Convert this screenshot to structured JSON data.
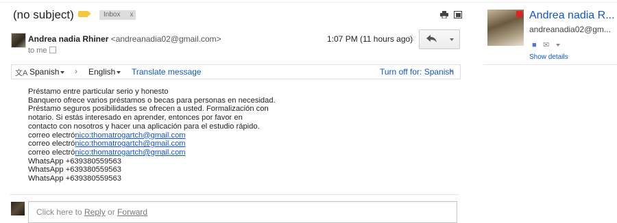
{
  "subject": "(no subject)",
  "label_color": "#f2c83e",
  "inbox_chip": {
    "label": "Inbox",
    "close": "x"
  },
  "sender": {
    "name": "Andrea nadia Rhiner",
    "email": "<andreanadia02@gmail.com>",
    "to": "to me",
    "time": "1:07 PM (11 hours ago)"
  },
  "translate": {
    "from": "Spanish",
    "arrow": "›",
    "to": "English",
    "action": "Translate message",
    "turn_off": "Turn off for: Spanish",
    "close": "×"
  },
  "body_lines": [
    "Préstamo entre particular serio y honesto",
    "Banquero ofrece varios préstamos o becas para personas en necesidad.",
    "Préstamo seguros posibilidades se ofrecen a usted. Formalización con",
    "notario. Si estás interesado en aprender, entonces por favor en",
    "contacto con nosotros y hacer una aplicación para el estudio rápido."
  ],
  "email_lines": [
    {
      "prefix": "correo electró",
      "link": "nico:thomatrogartch@gmail.com"
    },
    {
      "prefix": "correo electró",
      "link": "nico:thomatrogartch@gmail.com"
    },
    {
      "prefix": "correo electró",
      "link": "nico:thomatrogartch@gmail.com"
    }
  ],
  "whatsapp_lines": [
    "WhatsApp +639380559563",
    "WhatsApp +639380559563",
    "WhatsApp +639380559563"
  ],
  "reply_box": {
    "prefix": "Click here to ",
    "reply": "Reply",
    "or": " or ",
    "forward": "Forward"
  },
  "sidebar": {
    "name": "Andrea nadia R...",
    "email": "andreanadia02@gm...",
    "show_details": "Show details"
  },
  "icons": {
    "print": "print-icon",
    "new_window": "new-window-icon",
    "star": "star-icon",
    "reply": "reply-icon",
    "translate": "translate-icon"
  }
}
